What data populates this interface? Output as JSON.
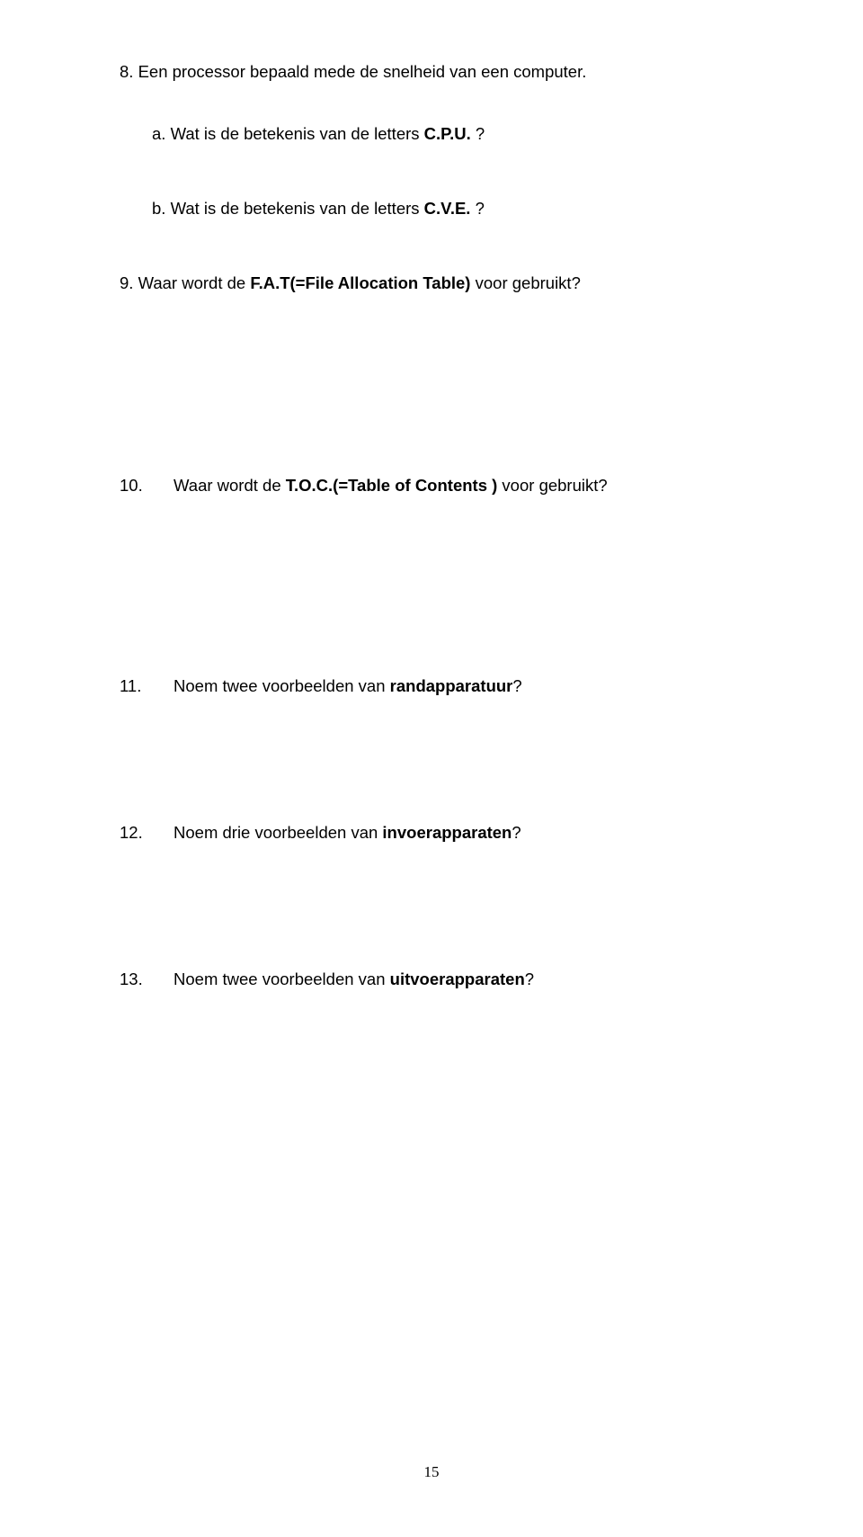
{
  "q8": {
    "prefix": "8. Een processor bepaald mede de snelheid van een computer.",
    "a_prefix": "a. Wat is de betekenis van de letters ",
    "a_bold": "C.P.U.",
    "a_suffix": " ?",
    "b_prefix": "b. Wat is de betekenis van de letters ",
    "b_bold": "C.V.E.",
    "b_suffix": " ?"
  },
  "q9": {
    "prefix": "9. Waar wordt de ",
    "bold": "F.A.T(=File Allocation Table)",
    "suffix": " voor gebruikt?"
  },
  "q10": {
    "num": "10.",
    "prefix": "Waar wordt de ",
    "bold": "T.O.C.(=Table of Contents )",
    "suffix": " voor gebruikt?"
  },
  "q11": {
    "num": "11.",
    "prefix": "Noem twee voorbeelden van ",
    "bold": "randapparatuur",
    "suffix": "?"
  },
  "q12": {
    "num": "12.",
    "prefix": "Noem drie voorbeelden van ",
    "bold": "invoerapparaten",
    "suffix": "?"
  },
  "q13": {
    "num": "13.",
    "prefix": "Noem twee voorbeelden van ",
    "bold": "uitvoerapparaten",
    "suffix": "?"
  },
  "page_number": "15"
}
